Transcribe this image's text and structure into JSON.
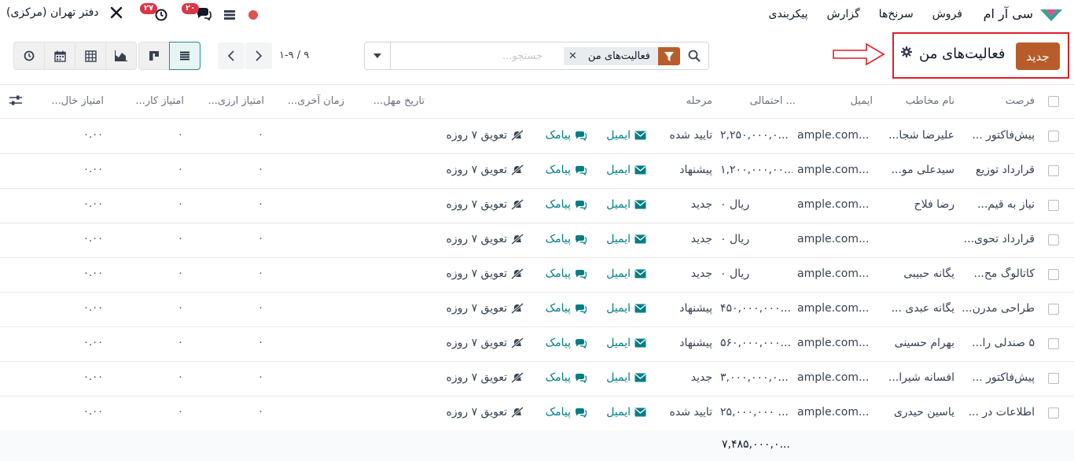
{
  "topnav": {
    "app_title": "سی آر ام",
    "menu": [
      "فروش",
      "سرنخ‌ها",
      "گزارش",
      "پیکربندی"
    ],
    "company": "دفتر تهران (مرکزی)",
    "activity_badge": "۲۷",
    "chat_badge": "۲۰"
  },
  "control": {
    "new_label": "جدید",
    "view_title": "فعالیت‌های من",
    "search_placeholder": "جستجو...",
    "facet_label": "فعالیت‌های من",
    "facet_close": "✕",
    "pager": "۱-۹ / ۹"
  },
  "table": {
    "headers": {
      "opportunity": "فرصت",
      "contact": "نام مخاطب",
      "email": "ایمیل",
      "expected": "... احتمالی",
      "stage": "مرحله",
      "deadline": "تاریخ مهل...",
      "last_time": "زمان آخری...",
      "value_score": "امتیاز ارزی...",
      "work_score": "امتیاز کار...",
      "net_score": "امتیاز خال..."
    },
    "actions": {
      "email": "ایمیل",
      "sms": "پیامک",
      "snooze": "تعویق ۷ روزه"
    },
    "rows": [
      {
        "opportunity": "پیش‌فاکتور ...",
        "contact": "علیرضا شجا...",
        "email": "ample.com...",
        "expected": "۲,۲۵۰,۰۰۰,۰...",
        "stage": "تایید شده",
        "value_score": "۰",
        "work_score": "۰",
        "net_score": "۰.۰۰"
      },
      {
        "opportunity": "قرارداد توزیع",
        "contact": "سیدعلی مو...",
        "email": "ample.com...",
        "expected": "۱,۲۰۰,۰۰۰,۰۰...",
        "stage": "پیشنهاد",
        "value_score": "۰",
        "work_score": "۰",
        "net_score": "۰.۰۰"
      },
      {
        "opportunity": "نیاز به قیم...",
        "contact": "رضا فلاح",
        "email": "ample.com...",
        "expected": "ریال ۰",
        "stage": "جدید",
        "value_score": "۰",
        "work_score": "۰",
        "net_score": "۰.۰۰"
      },
      {
        "opportunity": "قرارداد تحوی...",
        "contact": "",
        "email": "ample.com...",
        "expected": "ریال ۰",
        "stage": "جدید",
        "value_score": "۰",
        "work_score": "۰",
        "net_score": "۰.۰۰"
      },
      {
        "opportunity": "کاتالوگ مح...",
        "contact": "یگانه حبیبی",
        "email": "ample.com...",
        "expected": "ریال ۰",
        "stage": "جدید",
        "value_score": "۰",
        "work_score": "۰",
        "net_score": "۰.۰۰"
      },
      {
        "opportunity": "طراحی مدرن...",
        "contact": "یگانه عبدی ...",
        "email": "ample.com...",
        "expected": "۴۵۰,۰۰۰,۰۰۰...",
        "stage": "پیشنهاد",
        "value_score": "۰",
        "work_score": "۰",
        "net_score": "۰.۰۰"
      },
      {
        "opportunity": "۵ صندلی را...",
        "contact": "بهرام حسینی",
        "email": "ample.com...",
        "expected": "۵۶۰,۰۰۰,۰۰۰...",
        "stage": "پیشنهاد",
        "value_score": "۰",
        "work_score": "۰",
        "net_score": "۰.۰۰"
      },
      {
        "opportunity": "پیش‌فاکتور ...",
        "contact": "افسانه شیرا...",
        "email": "ample.com...",
        "expected": "۳,۰۰۰,۰۰۰,۰...",
        "stage": "جدید",
        "value_score": "۰",
        "work_score": "۰",
        "net_score": "۰.۰۰"
      },
      {
        "opportunity": "اطلاعات در ...",
        "contact": "یاسین حیدری",
        "email": "ample.com...",
        "expected": "۲۵,۰۰۰,۰۰۰ ...",
        "stage": "تایید شده",
        "value_score": "۰",
        "work_score": "۰",
        "net_score": "۰.۰۰"
      }
    ],
    "total_expected": "۷,۴۸۵,۰۰۰,۰..."
  },
  "colors": {
    "brand": "#b85c2c",
    "link": "#017e84",
    "highlight": "#e11d2a",
    "active_view": "#2a8c82"
  },
  "icons": [
    "crm-logo",
    "tools-icon",
    "activity-clock-icon",
    "chat-icon",
    "server-icon",
    "status-dot",
    "gear-icon",
    "annotation-arrow",
    "search-icon",
    "filter-icon",
    "caret-down-icon",
    "chevron-left-icon",
    "chevron-right-icon",
    "list-view-icon",
    "kanban-view-icon",
    "graph-view-icon",
    "pivot-view-icon",
    "calendar-view-icon",
    "activity-view-icon",
    "optional-columns-icon",
    "envelope-icon",
    "chat-bubble-icon",
    "snooze-icon"
  ]
}
